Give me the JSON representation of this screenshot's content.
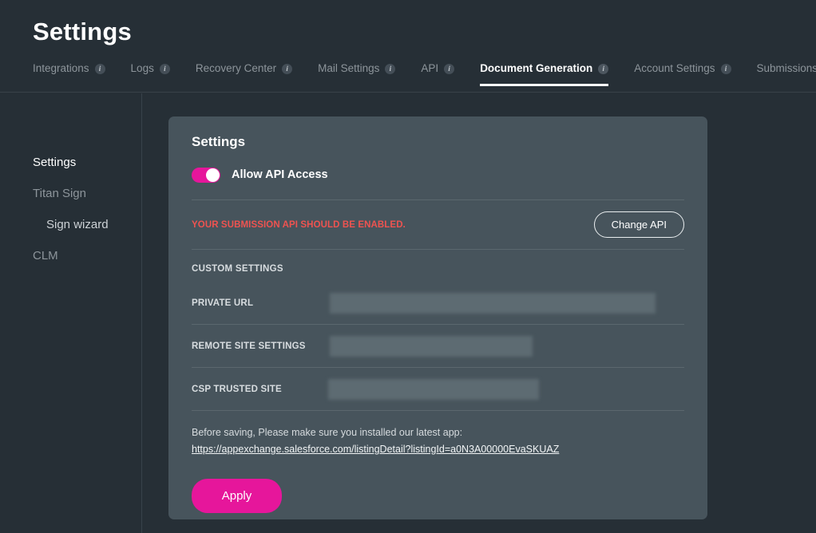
{
  "header": {
    "title": "Settings",
    "tabs": [
      {
        "label": "Integrations",
        "info": true,
        "active": false
      },
      {
        "label": "Logs",
        "info": true,
        "active": false
      },
      {
        "label": "Recovery Center",
        "info": true,
        "active": false
      },
      {
        "label": "Mail Settings",
        "info": true,
        "active": false
      },
      {
        "label": "API",
        "info": true,
        "active": false
      },
      {
        "label": "Document Generation",
        "info": true,
        "active": true
      },
      {
        "label": "Account Settings",
        "info": true,
        "active": false
      },
      {
        "label": "Submissions",
        "info": false,
        "active": false
      }
    ],
    "info_glyph": "i"
  },
  "sidebar": {
    "items": [
      {
        "label": "Settings",
        "current": true,
        "sub": false
      },
      {
        "label": "Titan Sign",
        "current": false,
        "sub": false
      },
      {
        "label": "Sign wizard",
        "current": false,
        "sub": true
      },
      {
        "label": "CLM",
        "current": false,
        "sub": false
      }
    ]
  },
  "card": {
    "title": "Settings",
    "toggle": {
      "label": "Allow API Access",
      "enabled": true
    },
    "warning": {
      "text": "YOUR SUBMISSION API SHOULD BE ENABLED.",
      "button_label": "Change API"
    },
    "custom_settings_label": "CUSTOM SETTINGS",
    "fields": [
      {
        "label": "PRIVATE URL",
        "value": "",
        "redacted": true
      },
      {
        "label": "REMOTE SITE SETTINGS",
        "value": "",
        "redacted": true
      },
      {
        "label": "CSP TRUSTED SITE",
        "value": "",
        "redacted": true
      }
    ],
    "note": {
      "text": "Before saving, Please make sure you installed our latest app:",
      "link": "https://appexchange.salesforce.com/listingDetail?listingId=a0N3A00000EvaSKUAZ"
    },
    "apply_label": "Apply"
  },
  "colors": {
    "page_bg": "#262f36",
    "card_bg": "#47545c",
    "accent": "#e6169b",
    "warning": "#ef5350",
    "muted_text": "#8d959b"
  }
}
